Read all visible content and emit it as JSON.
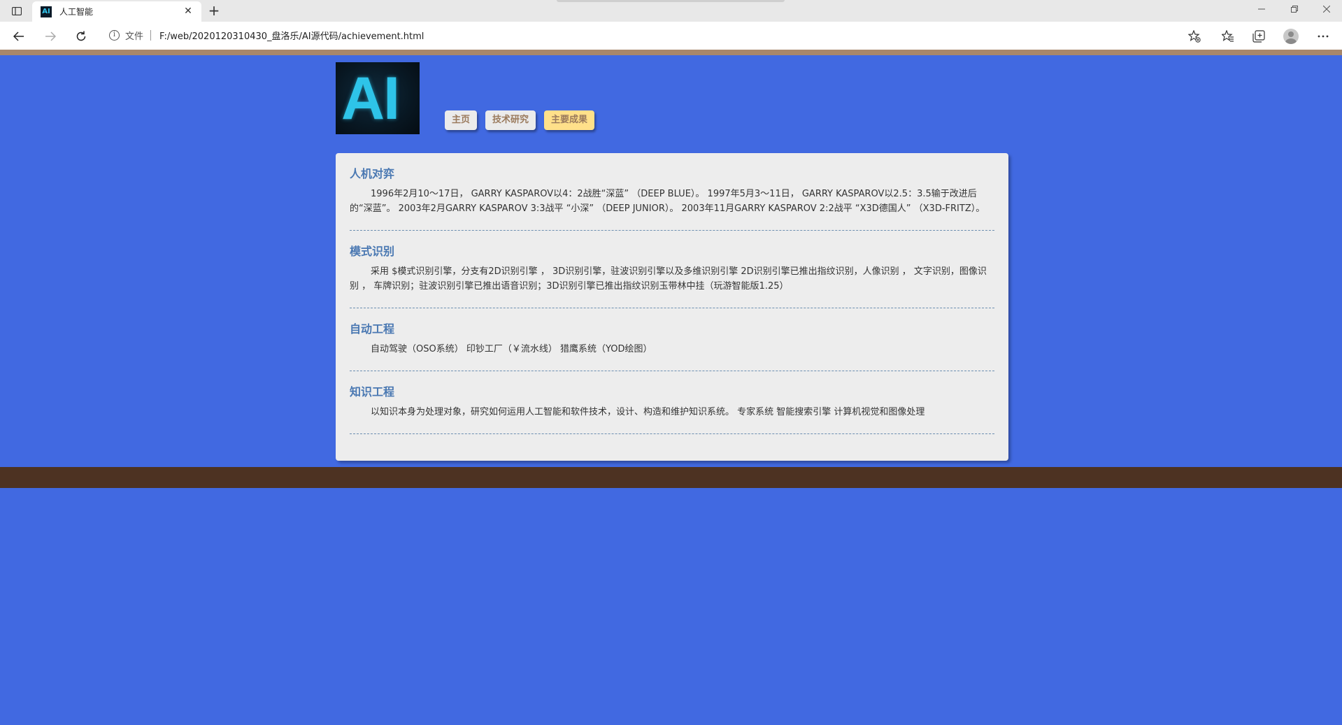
{
  "browser": {
    "tab_title": "人工智能",
    "tab_favicon": "AI",
    "address_prefix": "文件",
    "url": "F:/web/2020120310430_盘洛乐/AI源代码/achievement.html"
  },
  "site": {
    "logo_text": "AI",
    "nav": [
      "主页",
      "技术研究",
      "主要成果"
    ],
    "active_nav": "主要成果"
  },
  "sections": [
    {
      "title": "人机对弈",
      "text": "1996年2月10～17日， GARRY KASPAROV以4：2战胜“深蓝” （DEEP BLUE）。 1997年5月3～11日， GARRY KASPAROV以2.5：3.5输于改进后的“深蓝”。 2003年2月GARRY KASPAROV 3:3战平 “小深” （DEEP JUNIOR）。 2003年11月GARRY KASPAROV 2:2战平 “X3D德国人” （X3D-FRITZ）。"
    },
    {
      "title": "模式识别",
      "text": "采用 $模式识别引擎，分支有2D识别引擎 ， 3D识别引擎，驻波识别引擎以及多维识别引擎 2D识别引擎已推出指纹识别，人像识别 ， 文字识别，图像识别 ， 车牌识别；驻波识别引擎已推出语音识别；3D识别引擎已推出指纹识别玉带林中挂（玩游智能版1.25）"
    },
    {
      "title": "自动工程",
      "text": "自动驾驶（OSO系统） 印钞工厂（￥流水线） 猎鹰系统（YOD绘图）"
    },
    {
      "title": "知识工程",
      "text": "以知识本身为处理对象，研究如何运用人工智能和软件技术，设计、构造和维护知识系统。 专家系统 智能搜索引擎 计算机视觉和图像处理"
    }
  ],
  "colors": {
    "page_bg": "#4169e1",
    "top_stripe": "#a8876a",
    "footer_band": "#4d3222",
    "section_title": "#4a78b2",
    "active_nav": "#ffe08a"
  }
}
